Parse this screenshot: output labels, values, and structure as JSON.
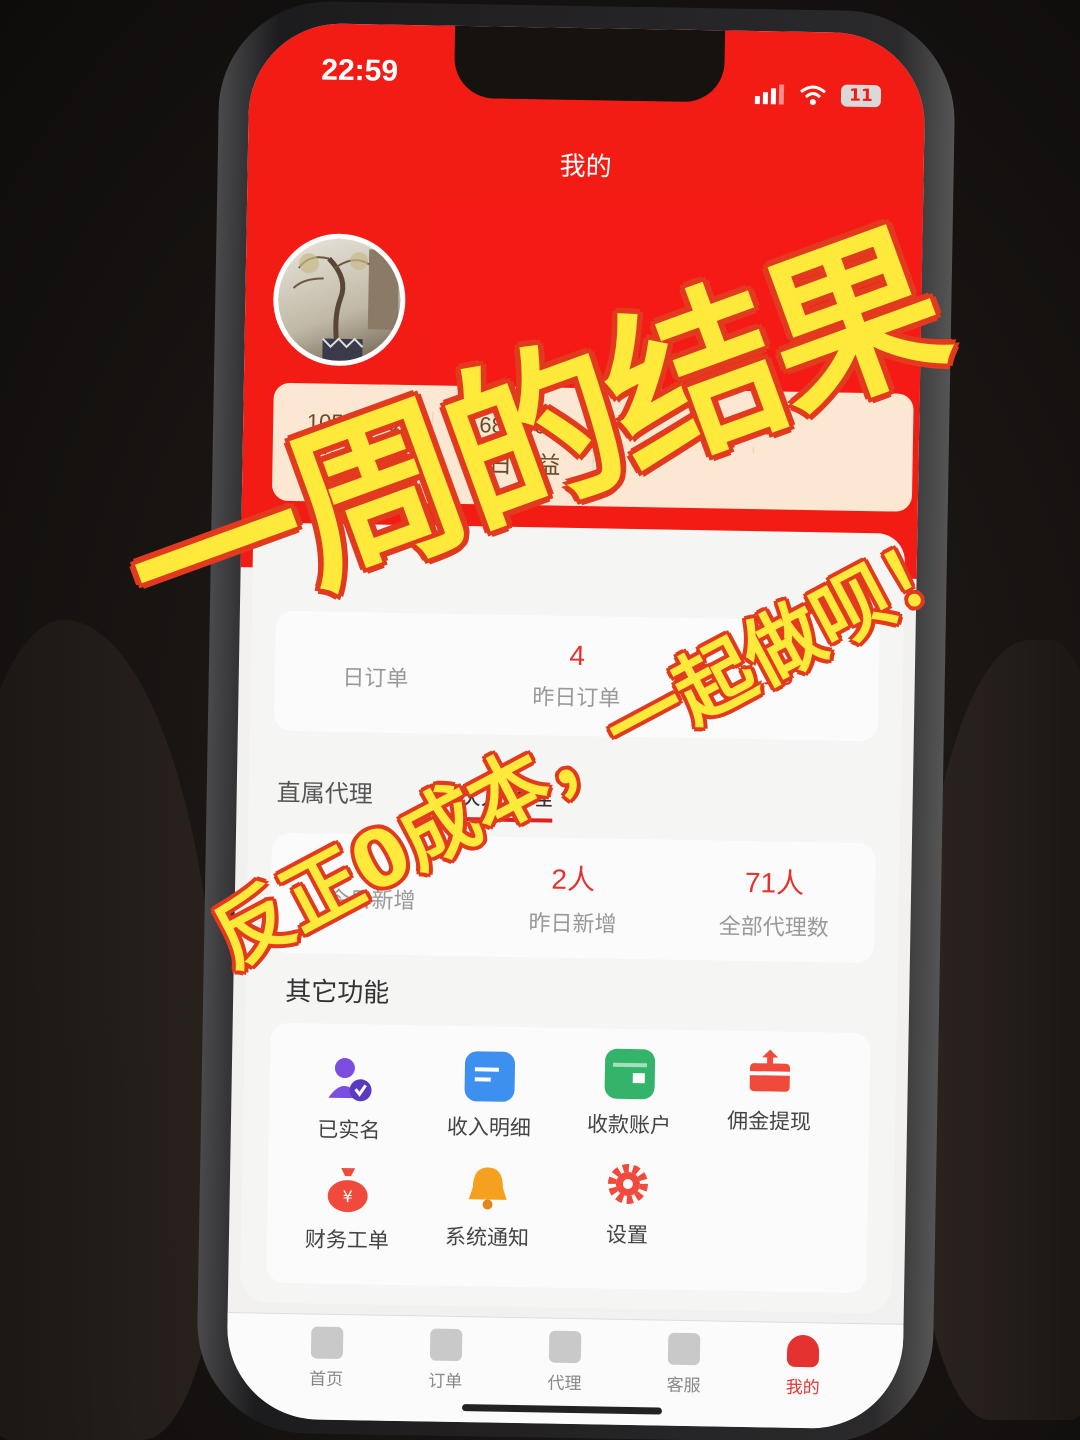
{
  "status_bar": {
    "time": "22:59",
    "battery": "11"
  },
  "header": {
    "title": "我的"
  },
  "earnings": [
    {
      "value": "10517.00",
      "label": "年度收益"
    },
    {
      "value": "680.00",
      "label": "昨日收益"
    },
    {
      "value": "",
      "label": ""
    },
    {
      "value": "",
      "label": ""
    }
  ],
  "orders": {
    "metrics": [
      {
        "value": "",
        "label": "日订单"
      },
      {
        "value": "4",
        "label": "昨日订单"
      },
      {
        "value": "16",
        "label": ""
      }
    ]
  },
  "agents": {
    "tabs": [
      {
        "label": "直属代理"
      },
      {
        "label": "合伙人代理"
      }
    ],
    "metrics": [
      {
        "value": "",
        "label": "今日新增"
      },
      {
        "value": "2人",
        "label": "昨日新增"
      },
      {
        "value": "71人",
        "label": "全部代理数"
      }
    ]
  },
  "other_functions": {
    "title": "其它功能",
    "items": [
      {
        "label": "已实名",
        "icon": "verified-user-icon",
        "color": "#7b4ee0"
      },
      {
        "label": "收入明细",
        "icon": "document-list-icon",
        "color": "#3d8ff0"
      },
      {
        "label": "收款账户",
        "icon": "wallet-icon",
        "color": "#34b36a"
      },
      {
        "label": "佣金提现",
        "icon": "withdraw-box-icon",
        "color": "#ef4a3c"
      },
      {
        "label": "财务工单",
        "icon": "money-bag-icon",
        "color": "#ef4a3c"
      },
      {
        "label": "系统通知",
        "icon": "bell-icon",
        "color": "#f5a01e"
      },
      {
        "label": "设置",
        "icon": "gear-icon",
        "color": "#ef4a3c"
      }
    ]
  },
  "tabbar": [
    {
      "label": "首页",
      "icon": "home-icon"
    },
    {
      "label": "订单",
      "icon": "order-icon"
    },
    {
      "label": "代理",
      "icon": "agent-icon"
    },
    {
      "label": "客服",
      "icon": "service-icon"
    },
    {
      "label": "我的",
      "icon": "profile-icon"
    }
  ],
  "overlay": {
    "headline": "一周的结果",
    "subline": "反正0成本，一起做呗！",
    "color": "#ffe93a",
    "outline_color": "#e23a1e"
  }
}
